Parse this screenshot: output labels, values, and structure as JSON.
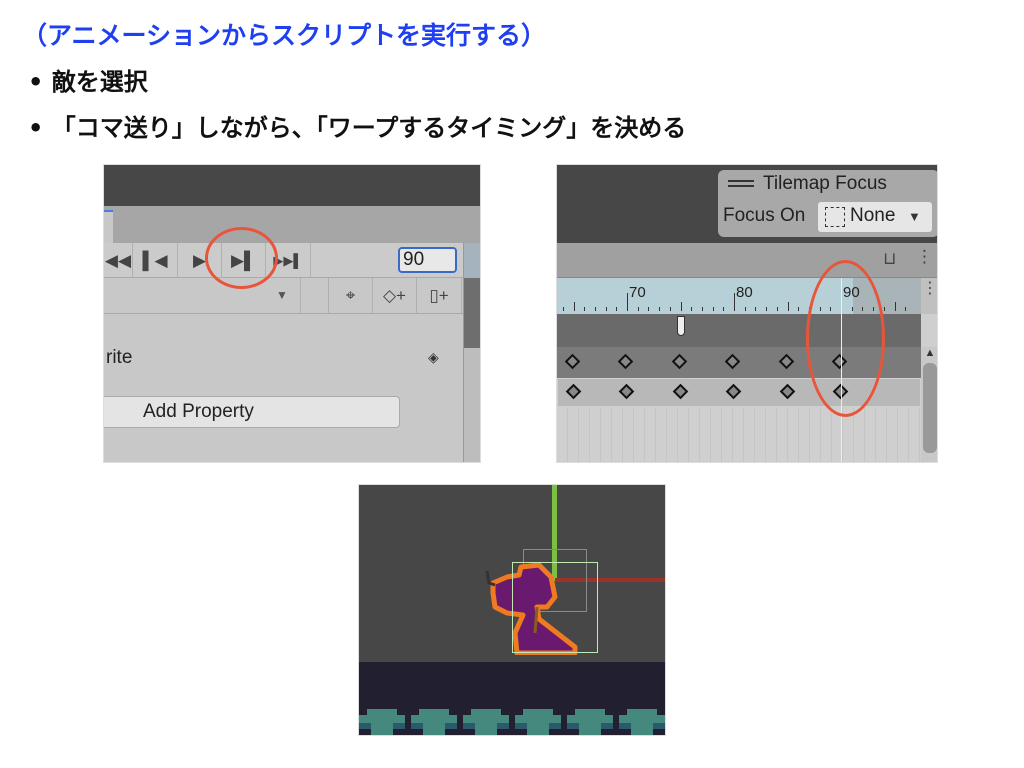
{
  "slide": {
    "title": "（アニメーションからスクリプトを実行する）",
    "bullets": [
      "• 敵を選択",
      "• 「コマ送り」しながら、「ワープするタイミング」を決める"
    ],
    "title_color": "#1f3ff2"
  },
  "animation_panel": {
    "frame_value": "90",
    "controls": [
      "first-frame",
      "previous-frame",
      "play",
      "next-frame",
      "last-frame"
    ],
    "highlighted_control": "next-frame",
    "property_label": "rite",
    "add_property_label": "Add Property",
    "highlight_color": "#e8553a"
  },
  "timeline_panel": {
    "overlay_title": "Tilemap Focus",
    "focus_on_label": "Focus On",
    "focus_on_value": "None",
    "ruler_ticks": [
      "70",
      "80",
      "90"
    ],
    "keyframe_frames": [
      65,
      70,
      75,
      80,
      85,
      90
    ],
    "current_frame": 90,
    "event_marker_frame": 75
  },
  "scene_panel": {
    "sprite": "purple-robed-enemy",
    "selection_color": "#b8e0a8"
  }
}
